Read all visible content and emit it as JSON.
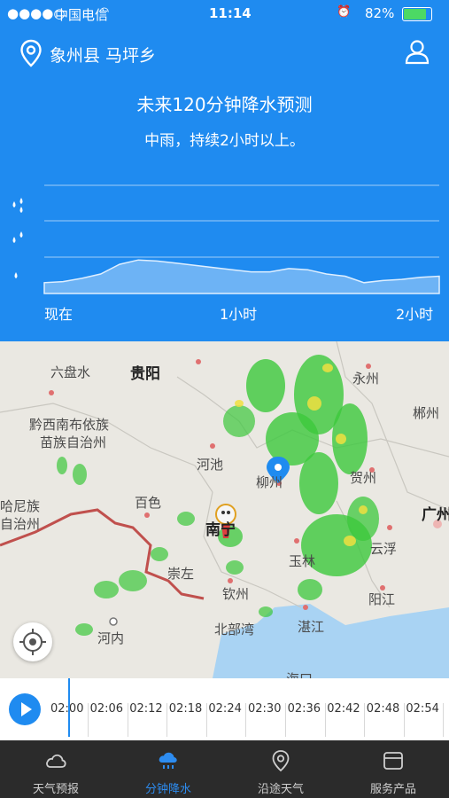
{
  "status_bar": {
    "carrier": "中国电信",
    "time": "11:14",
    "battery": "82%"
  },
  "header": {
    "location": "象州县 马坪乡",
    "location_icon": "location-pin-icon",
    "user_icon": "user-icon"
  },
  "forecast": {
    "title": "未来120分钟降水预测",
    "summary": "中雨，持续2小时以上。"
  },
  "chart_data": {
    "type": "area",
    "x_labels": [
      "现在",
      "1小时",
      "2小时"
    ],
    "y_levels": [
      "light",
      "moderate",
      "heavy"
    ],
    "series": [
      {
        "values": [
          0.1,
          0.11,
          0.14,
          0.18,
          0.27,
          0.31,
          0.3,
          0.28,
          0.26,
          0.24,
          0.22,
          0.2,
          0.2,
          0.23,
          0.22,
          0.18,
          0.16,
          0.1,
          0.12,
          0.13,
          0.15,
          0.16
        ]
      }
    ]
  },
  "map": {
    "places": [
      "六盘水",
      "贵阳",
      "永州",
      "郴州",
      "黔西南布依族",
      "苗族自治州",
      "河池",
      "柳州",
      "贺州",
      "哈尼族",
      "自治州",
      "百色",
      "南宁",
      "广州",
      "云浮",
      "崇左",
      "玉林",
      "钦州",
      "阳江",
      "河内",
      "北部湾",
      "湛江",
      "海口"
    ]
  },
  "timeline": {
    "ticks": [
      "02:00",
      "02:06",
      "02:12",
      "02:18",
      "02:24",
      "02:30",
      "02:36",
      "02:42",
      "02:48",
      "02:54"
    ]
  },
  "tabs": [
    {
      "label": "天气预报",
      "icon": "cloud-icon"
    },
    {
      "label": "分钟降水",
      "icon": "rain-cloud-icon",
      "active": true
    },
    {
      "label": "沿途天气",
      "icon": "location-pin-icon"
    },
    {
      "label": "服务产品",
      "icon": "box-icon"
    }
  ],
  "colors": {
    "primary": "#1f8bf0",
    "tabbar": "#2b2b2b",
    "radar_green": "#3cc83c"
  }
}
